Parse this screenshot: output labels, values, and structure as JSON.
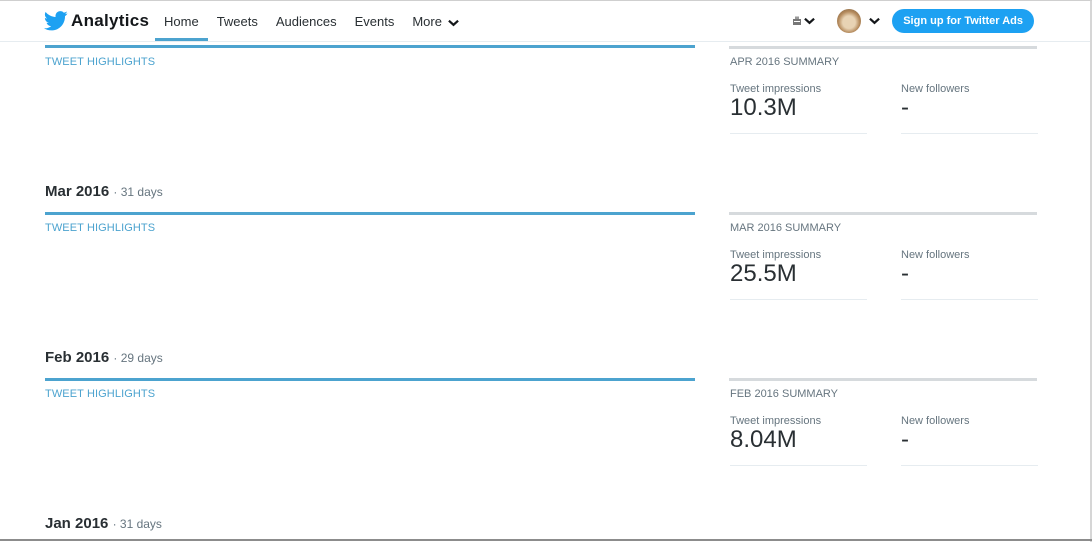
{
  "nav": {
    "brand": "Analytics",
    "items": [
      {
        "label": "Home",
        "active": true
      },
      {
        "label": "Tweets",
        "active": false
      },
      {
        "label": "Audiences",
        "active": false
      },
      {
        "label": "Events",
        "active": false
      },
      {
        "label": "More",
        "active": false
      }
    ],
    "store_icon": "store-icon",
    "avatar_icon": "avatar",
    "ads_button": "Sign up for Twitter Ads"
  },
  "sections": [
    {
      "month": "",
      "days": "",
      "highlights_label": "TWEET HIGHLIGHTS",
      "summary_label": "APR 2016 SUMMARY",
      "impressions_label": "Tweet impressions",
      "impressions_value": "10.3M",
      "followers_label": "New followers",
      "followers_value": "-"
    },
    {
      "month": "Mar 2016",
      "days": "31 days",
      "highlights_label": "TWEET HIGHLIGHTS",
      "summary_label": "MAR 2016 SUMMARY",
      "impressions_label": "Tweet impressions",
      "impressions_value": "25.5M",
      "followers_label": "New followers",
      "followers_value": "-"
    },
    {
      "month": "Feb 2016",
      "days": "29 days",
      "highlights_label": "TWEET HIGHLIGHTS",
      "summary_label": "FEB 2016 SUMMARY",
      "impressions_label": "Tweet impressions",
      "impressions_value": "8.04M",
      "followers_label": "New followers",
      "followers_value": "-"
    },
    {
      "month": "Jan 2016",
      "days": "31 days"
    }
  ],
  "separator": "·",
  "colors": {
    "accent": "#4ca3cf",
    "button": "#1da1f2",
    "muted": "#66757f"
  }
}
